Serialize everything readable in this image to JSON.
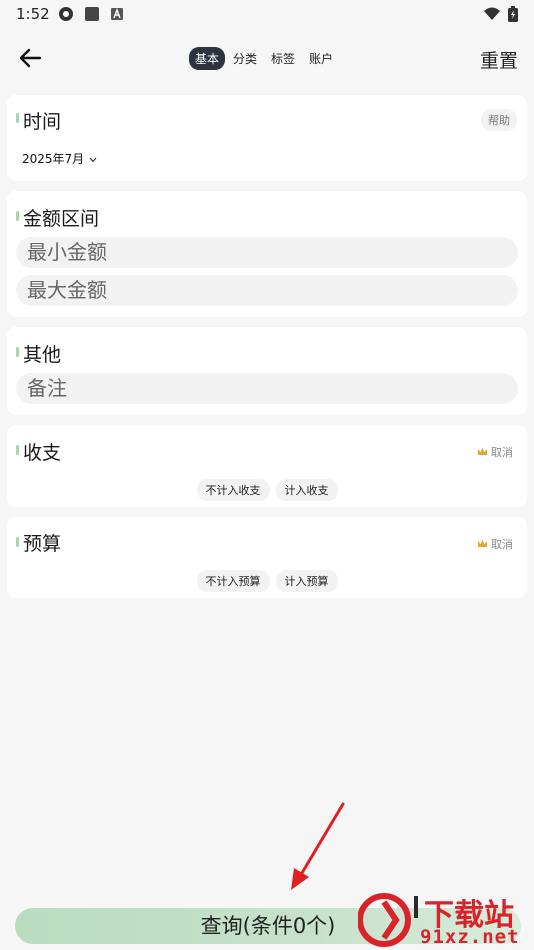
{
  "status_bar": {
    "time": "1:52"
  },
  "header": {
    "tabs": [
      {
        "label": "基本",
        "active": true
      },
      {
        "label": "分类",
        "active": false
      },
      {
        "label": "标签",
        "active": false
      },
      {
        "label": "账户",
        "active": false
      }
    ],
    "reset_label": "重置"
  },
  "time_card": {
    "title": "时间",
    "help_label": "帮助",
    "date_value": "2025年7月"
  },
  "amount_card": {
    "title": "金额区间",
    "min_placeholder": "最小金额",
    "max_placeholder": "最大金额"
  },
  "other_card": {
    "title": "其他",
    "note_placeholder": "备注"
  },
  "income_card": {
    "title": "收支",
    "cancel_label": "取消",
    "chips": [
      "不计入收支",
      "计入收支"
    ]
  },
  "budget_card": {
    "title": "预算",
    "cancel_label": "取消",
    "chips": [
      "不计入预算",
      "计入预算"
    ]
  },
  "query_button": {
    "label": "查询(条件0个)"
  },
  "watermark": {
    "brand": "下载站",
    "domain": "91xz.net"
  },
  "colors": {
    "accent": "#a8d5b0",
    "active_tab": "#2d3440",
    "query_button": "#b9dcbf",
    "arrow": "#e02020",
    "watermark_red": "#d8232a"
  }
}
